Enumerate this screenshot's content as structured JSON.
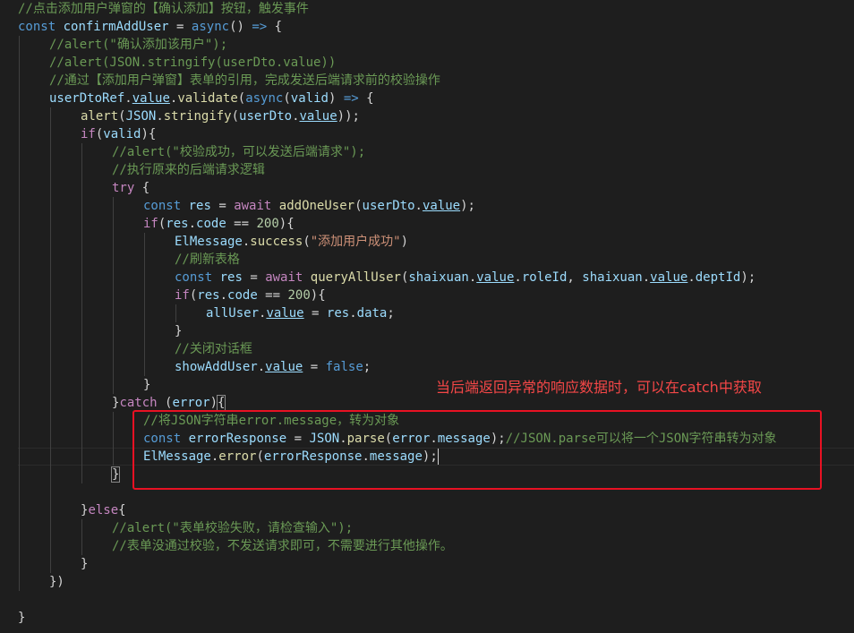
{
  "lines": [
    {
      "indent": 0,
      "tokens": [
        {
          "t": "c",
          "v": "//点击添加用户弹窗的【确认添加】按钮，触发事件"
        }
      ]
    },
    {
      "indent": 0,
      "tokens": [
        {
          "t": "k",
          "v": "const"
        },
        {
          "t": "p",
          "v": " "
        },
        {
          "t": "v",
          "v": "confirmAddUser"
        },
        {
          "t": "p",
          "v": " = "
        },
        {
          "t": "k",
          "v": "async"
        },
        {
          "t": "p",
          "v": "() "
        },
        {
          "t": "k",
          "v": "=>"
        },
        {
          "t": "p",
          "v": " {"
        }
      ]
    },
    {
      "indent": 1,
      "tokens": [
        {
          "t": "c",
          "v": "//alert(\"确认添加该用户\");"
        }
      ]
    },
    {
      "indent": 1,
      "tokens": [
        {
          "t": "c",
          "v": "//alert(JSON.stringify(userDto.value))"
        }
      ]
    },
    {
      "indent": 1,
      "tokens": [
        {
          "t": "c",
          "v": "//通过【添加用户弹窗】表单的引用，完成发送后端请求前的校验操作"
        }
      ]
    },
    {
      "indent": 1,
      "tokens": [
        {
          "t": "v",
          "v": "userDtoRef"
        },
        {
          "t": "p",
          "v": "."
        },
        {
          "t": "vu",
          "v": "value"
        },
        {
          "t": "p",
          "v": "."
        },
        {
          "t": "f",
          "v": "validate"
        },
        {
          "t": "p",
          "v": "("
        },
        {
          "t": "k",
          "v": "async"
        },
        {
          "t": "p",
          "v": "("
        },
        {
          "t": "v",
          "v": "valid"
        },
        {
          "t": "p",
          "v": ") "
        },
        {
          "t": "k",
          "v": "=>"
        },
        {
          "t": "p",
          "v": " {"
        }
      ]
    },
    {
      "indent": 2,
      "tokens": [
        {
          "t": "f",
          "v": "alert"
        },
        {
          "t": "p",
          "v": "("
        },
        {
          "t": "v",
          "v": "JSON"
        },
        {
          "t": "p",
          "v": "."
        },
        {
          "t": "f",
          "v": "stringify"
        },
        {
          "t": "p",
          "v": "("
        },
        {
          "t": "v",
          "v": "userDto"
        },
        {
          "t": "p",
          "v": "."
        },
        {
          "t": "vu",
          "v": "value"
        },
        {
          "t": "p",
          "v": "));"
        }
      ]
    },
    {
      "indent": 2,
      "tokens": [
        {
          "t": "ctl",
          "v": "if"
        },
        {
          "t": "p",
          "v": "("
        },
        {
          "t": "v",
          "v": "valid"
        },
        {
          "t": "p",
          "v": "){"
        }
      ]
    },
    {
      "indent": 3,
      "tokens": [
        {
          "t": "c",
          "v": "//alert(\"校验成功，可以发送后端请求\");"
        }
      ]
    },
    {
      "indent": 3,
      "tokens": [
        {
          "t": "c",
          "v": "//执行原来的后端请求逻辑"
        }
      ]
    },
    {
      "indent": 3,
      "tokens": [
        {
          "t": "ctl",
          "v": "try"
        },
        {
          "t": "p",
          "v": " {"
        }
      ]
    },
    {
      "indent": 4,
      "tokens": [
        {
          "t": "k",
          "v": "const"
        },
        {
          "t": "p",
          "v": " "
        },
        {
          "t": "v",
          "v": "res"
        },
        {
          "t": "p",
          "v": " = "
        },
        {
          "t": "ctl",
          "v": "await"
        },
        {
          "t": "p",
          "v": " "
        },
        {
          "t": "f",
          "v": "addOneUser"
        },
        {
          "t": "p",
          "v": "("
        },
        {
          "t": "v",
          "v": "userDto"
        },
        {
          "t": "p",
          "v": "."
        },
        {
          "t": "vu",
          "v": "value"
        },
        {
          "t": "p",
          "v": ");"
        }
      ]
    },
    {
      "indent": 4,
      "tokens": [
        {
          "t": "ctl",
          "v": "if"
        },
        {
          "t": "p",
          "v": "("
        },
        {
          "t": "v",
          "v": "res"
        },
        {
          "t": "p",
          "v": "."
        },
        {
          "t": "v",
          "v": "code"
        },
        {
          "t": "p",
          "v": " == "
        },
        {
          "t": "n",
          "v": "200"
        },
        {
          "t": "p",
          "v": "){"
        }
      ]
    },
    {
      "indent": 5,
      "tokens": [
        {
          "t": "v",
          "v": "ElMessage"
        },
        {
          "t": "p",
          "v": "."
        },
        {
          "t": "f",
          "v": "success"
        },
        {
          "t": "p",
          "v": "("
        },
        {
          "t": "s",
          "v": "\"添加用户成功\""
        },
        {
          "t": "p",
          "v": ")"
        }
      ]
    },
    {
      "indent": 5,
      "tokens": [
        {
          "t": "c",
          "v": "//刷新表格"
        }
      ]
    },
    {
      "indent": 5,
      "tokens": [
        {
          "t": "k",
          "v": "const"
        },
        {
          "t": "p",
          "v": " "
        },
        {
          "t": "v",
          "v": "res"
        },
        {
          "t": "p",
          "v": " = "
        },
        {
          "t": "ctl",
          "v": "await"
        },
        {
          "t": "p",
          "v": " "
        },
        {
          "t": "f",
          "v": "queryAllUser"
        },
        {
          "t": "p",
          "v": "("
        },
        {
          "t": "v",
          "v": "shaixuan"
        },
        {
          "t": "p",
          "v": "."
        },
        {
          "t": "vu",
          "v": "value"
        },
        {
          "t": "p",
          "v": "."
        },
        {
          "t": "v",
          "v": "roleId"
        },
        {
          "t": "p",
          "v": ", "
        },
        {
          "t": "v",
          "v": "shaixuan"
        },
        {
          "t": "p",
          "v": "."
        },
        {
          "t": "vu",
          "v": "value"
        },
        {
          "t": "p",
          "v": "."
        },
        {
          "t": "v",
          "v": "deptId"
        },
        {
          "t": "p",
          "v": ");"
        }
      ]
    },
    {
      "indent": 5,
      "tokens": [
        {
          "t": "ctl",
          "v": "if"
        },
        {
          "t": "p",
          "v": "("
        },
        {
          "t": "v",
          "v": "res"
        },
        {
          "t": "p",
          "v": "."
        },
        {
          "t": "v",
          "v": "code"
        },
        {
          "t": "p",
          "v": " == "
        },
        {
          "t": "n",
          "v": "200"
        },
        {
          "t": "p",
          "v": "){"
        }
      ]
    },
    {
      "indent": 6,
      "tokens": [
        {
          "t": "v",
          "v": "allUser"
        },
        {
          "t": "p",
          "v": "."
        },
        {
          "t": "vu",
          "v": "value"
        },
        {
          "t": "p",
          "v": " = "
        },
        {
          "t": "v",
          "v": "res"
        },
        {
          "t": "p",
          "v": "."
        },
        {
          "t": "v",
          "v": "data"
        },
        {
          "t": "p",
          "v": ";"
        }
      ]
    },
    {
      "indent": 5,
      "tokens": [
        {
          "t": "p",
          "v": "}"
        }
      ]
    },
    {
      "indent": 5,
      "tokens": [
        {
          "t": "c",
          "v": "//关闭对话框"
        }
      ]
    },
    {
      "indent": 5,
      "tokens": [
        {
          "t": "v",
          "v": "showAddUser"
        },
        {
          "t": "p",
          "v": "."
        },
        {
          "t": "vu",
          "v": "value"
        },
        {
          "t": "p",
          "v": " = "
        },
        {
          "t": "k",
          "v": "false"
        },
        {
          "t": "p",
          "v": ";"
        }
      ]
    },
    {
      "indent": 4,
      "tokens": [
        {
          "t": "p",
          "v": "}"
        }
      ]
    },
    {
      "indent": 3,
      "tokens": [
        {
          "t": "p",
          "v": "}"
        },
        {
          "t": "ctl",
          "v": "catch"
        },
        {
          "t": "p",
          "v": " ("
        },
        {
          "t": "v",
          "v": "error"
        },
        {
          "t": "p",
          "v": ")"
        },
        {
          "t": "pb",
          "v": "{"
        }
      ]
    },
    {
      "indent": 4,
      "tokens": [
        {
          "t": "c",
          "v": "//将JSON字符串error.message，转为对象"
        }
      ]
    },
    {
      "indent": 4,
      "tokens": [
        {
          "t": "k",
          "v": "const"
        },
        {
          "t": "p",
          "v": " "
        },
        {
          "t": "v",
          "v": "errorResponse"
        },
        {
          "t": "p",
          "v": " = "
        },
        {
          "t": "v",
          "v": "JSON"
        },
        {
          "t": "p",
          "v": "."
        },
        {
          "t": "f",
          "v": "parse"
        },
        {
          "t": "p",
          "v": "("
        },
        {
          "t": "v",
          "v": "error"
        },
        {
          "t": "p",
          "v": "."
        },
        {
          "t": "v",
          "v": "message"
        },
        {
          "t": "p",
          "v": ");"
        },
        {
          "t": "c",
          "v": "//JSON.parse可以将一个JSON字符串转为对象"
        }
      ]
    },
    {
      "indent": 4,
      "tokens": [
        {
          "t": "v",
          "v": "ElMessage"
        },
        {
          "t": "p",
          "v": "."
        },
        {
          "t": "f",
          "v": "error"
        },
        {
          "t": "p",
          "v": "("
        },
        {
          "t": "v",
          "v": "errorResponse"
        },
        {
          "t": "p",
          "v": "."
        },
        {
          "t": "v",
          "v": "message"
        },
        {
          "t": "p",
          "v": ");"
        },
        {
          "t": "caret",
          "v": ""
        }
      ]
    },
    {
      "indent": 3,
      "tokens": [
        {
          "t": "pb",
          "v": "}"
        }
      ]
    },
    {
      "indent": 0,
      "tokens": []
    },
    {
      "indent": 2,
      "tokens": [
        {
          "t": "p",
          "v": "}"
        },
        {
          "t": "ctl",
          "v": "else"
        },
        {
          "t": "p",
          "v": "{"
        }
      ]
    },
    {
      "indent": 3,
      "tokens": [
        {
          "t": "c",
          "v": "//alert(\"表单校验失败，请检查输入\");"
        }
      ]
    },
    {
      "indent": 3,
      "tokens": [
        {
          "t": "c",
          "v": "//表单没通过校验，不发送请求即可，不需要进行其他操作。"
        }
      ]
    },
    {
      "indent": 2,
      "tokens": [
        {
          "t": "p",
          "v": "}"
        }
      ]
    },
    {
      "indent": 1,
      "tokens": [
        {
          "t": "p",
          "v": "})"
        }
      ]
    },
    {
      "indent": 0,
      "tokens": []
    },
    {
      "indent": 0,
      "tokens": [
        {
          "t": "p",
          "v": "}"
        }
      ]
    }
  ],
  "annotation": {
    "text": "当后端返回异常的响应数据时，可以在catch中获取",
    "color": "#f44747"
  },
  "highlight_box_color": "#e81123"
}
